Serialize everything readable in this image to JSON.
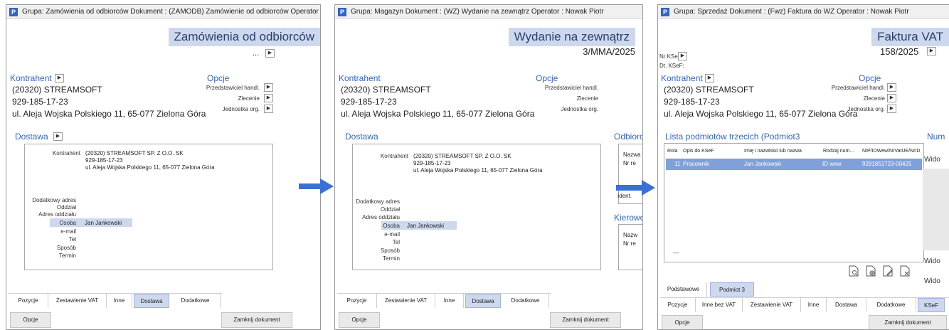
{
  "panels": [
    {
      "title": "Grupa: Zamówienia od odbiorców   Dokument : (ZAMODB) Zamówienie od odbiorców   Operator : Nowak Piotr",
      "doc_title": "Zamówienia od odbiorców",
      "doc_number": "...",
      "kontrahent_label": "Kontrahent",
      "kontrahent_lines": [
        "(20320) STREAMSOFT",
        "929-185-17-23",
        "ul. Aleja Wojska Polskiego 11, 65-077 Zielona Góra"
      ],
      "opcje_label": "Opcje",
      "opcje_items": [
        "Przedstawiciel handl.",
        "Zlecenie",
        "Jednostka org."
      ],
      "dostawa_label": "Dostawa",
      "dostawa_kontrahent_label": "Kontrahent",
      "dostawa_kontrahent_lines": [
        "(20320) STREAMSOFT SP. Z O.O. SK",
        "929-185-17-23",
        "ul. Aleja Wojska Polskiego 11, 65-077 Zielona Góra"
      ],
      "dostawa_fields": [
        "Dodatkowy adres",
        "Oddział",
        "Adres oddziału",
        "Osoba",
        "e-mail",
        "Tel",
        "Sposób",
        "Termin"
      ],
      "osoba_value": "Jan Jankowski",
      "tabs": [
        "Pozycje",
        "Zestawienie VAT",
        "Inne",
        "Dostawa",
        "Dodatkowe"
      ],
      "active_tab": "Dostawa",
      "btn_opcje": "Opcje",
      "btn_zamknij": "Zamknij dokument"
    },
    {
      "title": "Grupa: Magazyn   Dokument : (WZ) Wydanie na zewnątrz   Operator : Nowak Piotr",
      "doc_title": "Wydanie na zewnątrz",
      "doc_number": "3/MMA/2025",
      "kontrahent_label": "Kontrahent",
      "kontrahent_lines": [
        "(20320) STREAMSOFT",
        "929-185-17-23",
        "ul. Aleja Wojska Polskiego 11, 65-077 Zielona Góra"
      ],
      "opcje_label": "Opcje",
      "opcje_items": [
        "Przedstawiciel handl.",
        "Zlecenie",
        "Jednostka org."
      ],
      "dostawa_label": "Dostawa",
      "dostawa_kontrahent_label": "Kontrahent",
      "dostawa_kontrahent_lines": [
        "(20320) STREAMSOFT SP. Z O.O. SK",
        "929-185-17-23",
        "ul. Aleja Wojska Polskiego 11, 65-077 Zielona Góra"
      ],
      "dostawa_fields": [
        "Dodatkowy adres",
        "Oddział",
        "Adres oddziału",
        "Osoba",
        "e-mail",
        "Tel",
        "Sposób",
        "Termin"
      ],
      "osoba_value": "Jan Jankowski",
      "odbiorca_label": "Odbiorca",
      "odbiorca_fields": [
        "Nazwa",
        "Nr re",
        "Rola",
        "Ident."
      ],
      "kierowca_label": "Kierowca",
      "kierowca_fields": [
        "Nazw",
        "Nr re"
      ],
      "tabs": [
        "Pozycje",
        "Zestawienie VAT",
        "Inne",
        "Dostawa",
        "Dodatkowe"
      ],
      "active_tab": "Dostawa",
      "btn_opcje": "Opcje",
      "btn_zamknij": "Zamknij dokument"
    },
    {
      "title": "Grupa: Sprzedaż   Dokument : (Fwz) Faktura do WZ   Operator : Nowak Piotr",
      "doc_title": "Faktura VAT",
      "doc_number": "158/2025",
      "nr_ksef_label": "Nr KSeF:",
      "dt_ksef_label": "Dt. KSeF:",
      "kontrahent_label": "Kontrahent",
      "kontrahent_lines": [
        "(20320) STREAMSOFT",
        "929-185-17-23",
        "ul. Aleja Wojska Polskiego 11, 65-077 Zielona Góra"
      ],
      "opcje_label": "Opcje",
      "opcje_items": [
        "Przedstawiciel handl.",
        "Zlecenie",
        "Jednostka org."
      ],
      "lista_label": "Lista podmiotów trzecich (Podmiot3",
      "num_label": "Num",
      "wide_labels": [
        "Wido",
        "Wido",
        "Wido"
      ],
      "grid_headers": [
        "Rola",
        "Opis do KSeF",
        "Imię i nazwisko lub nazwa",
        "Rodzaj num...",
        "NIP/IDWew/NrVatUE/NrID"
      ],
      "grid_row": [
        "11",
        "Pracownik",
        "Jan Jankowski",
        "ID wew.",
        "9291851723-00425"
      ],
      "grid_footer": "—",
      "subtabs": [
        "Podstawowe",
        "Podmiot 3"
      ],
      "active_subtab": "Podmiot 3",
      "tabs": [
        "Pozycje",
        "Inne bez VAT",
        "Zestawienie VAT",
        "Inne",
        "Dostawa",
        "Dodatkowe",
        "KSeF"
      ],
      "active_tab": "KSeF",
      "btn_opcje": "Opcje",
      "btn_zamknij": "Zamknij dokument"
    }
  ],
  "icons": {
    "app": "P",
    "arrow_btn": "▶",
    "flow_arrow": "arrow-right-icon",
    "doc_actions": [
      "document-search-icon",
      "document-add-icon",
      "document-edit-icon",
      "document-delete-icon"
    ]
  },
  "colors": {
    "accent": "#2f64c8",
    "highlight": "#cdd8ee",
    "grid_selected": "#7fa0d8",
    "flow_arrow": "#3a6fd6"
  }
}
